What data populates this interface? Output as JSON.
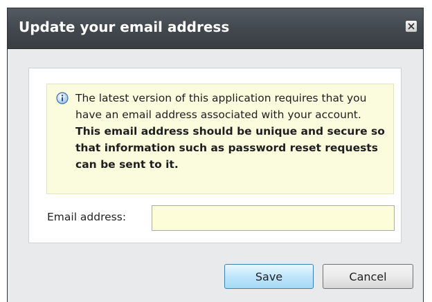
{
  "dialog": {
    "title": "Update your email address",
    "close_icon": "close-icon"
  },
  "info": {
    "icon": "info-icon",
    "text_normal": "The latest version of this application requires that you have an email address associated with your account. ",
    "text_bold": "This email address should be unique and secure so that information such as password reset requests can be sent to it."
  },
  "form": {
    "email_label": "Email address:",
    "email_value": ""
  },
  "buttons": {
    "save_label": "Save",
    "cancel_label": "Cancel"
  },
  "colors": {
    "titlebar": "#41474d",
    "info_background": "#fbfbde",
    "input_background": "#fdfdd9",
    "save_button": "#bee6fd"
  }
}
